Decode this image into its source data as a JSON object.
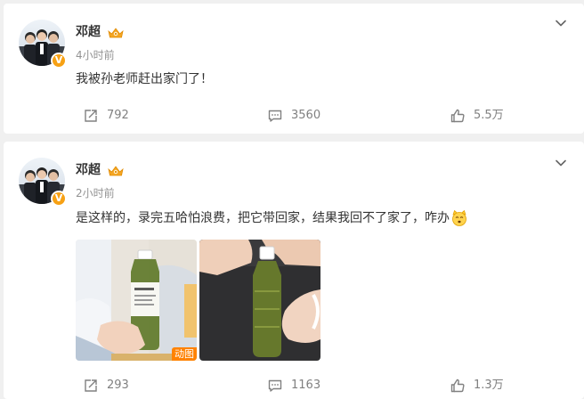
{
  "posts": [
    {
      "author": "邓超",
      "time": "4小时前",
      "text": "我被孙老师赶出家门了！",
      "reposts": "792",
      "comments": "3560",
      "likes": "5.5万",
      "icons": {
        "repost": "repost-icon",
        "comment": "comment-icon",
        "like": "like-icon",
        "menu": "chevron-down-icon"
      }
    },
    {
      "author": "邓超",
      "time": "2小时前",
      "text": "是这样的，录完五哈怕浪费，把它带回家，结果我回不了家了，咋办",
      "emoji": "cat-face-emoji",
      "gif_tag": "动图",
      "reposts": "293",
      "comments": "1163",
      "likes": "1.3万",
      "icons": {
        "repost": "repost-icon",
        "comment": "comment-icon",
        "like": "like-icon",
        "menu": "chevron-down-icon"
      }
    }
  ],
  "colors": {
    "background": "#f0f0f0",
    "card": "#ffffff",
    "name": "#333333",
    "meta": "#939393",
    "action": "#808080",
    "verified": "#f7a114",
    "gif_tag": "#ff8200"
  }
}
